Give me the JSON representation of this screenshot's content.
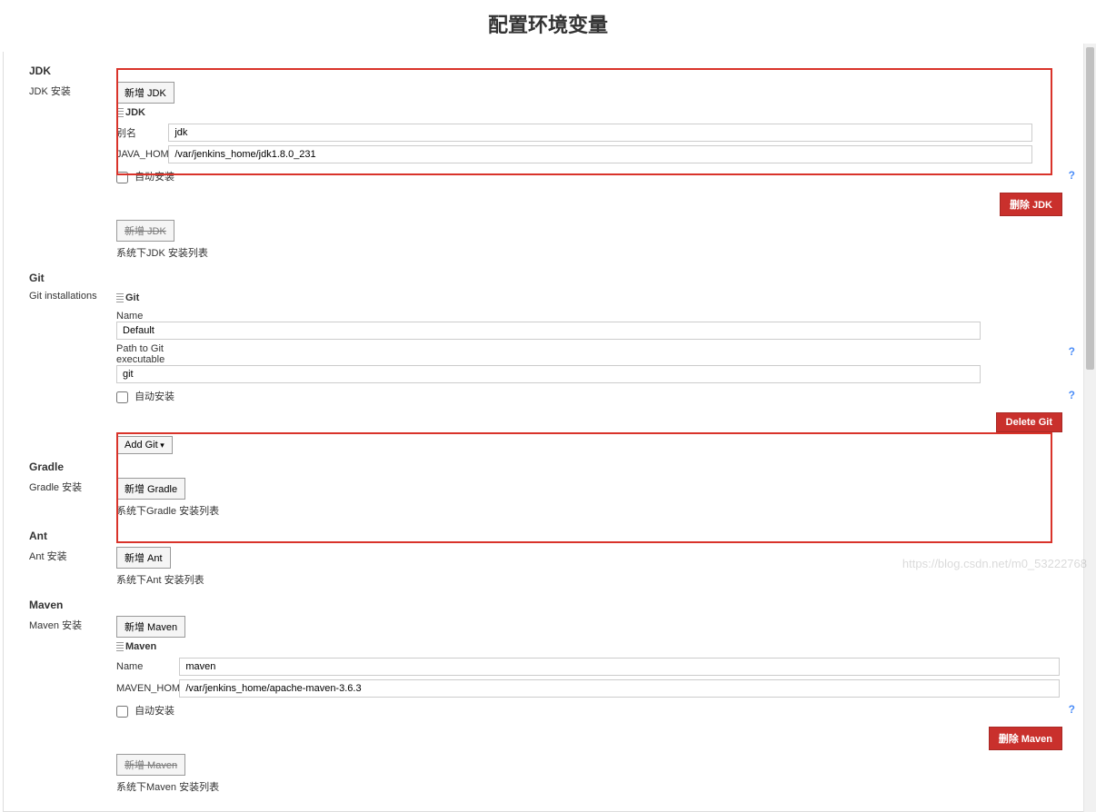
{
  "page": {
    "title": "配置环境变量"
  },
  "jdk": {
    "header": "JDK",
    "install_label": "JDK 安装",
    "add_button": "新增 JDK",
    "tool_title": "JDK",
    "alias_label": "别名",
    "alias_value": "jdk",
    "home_label": "JAVA_HOME",
    "home_value": "/var/jenkins_home/jdk1.8.0_231",
    "auto_install_label": "自动安装",
    "delete_button": "删除 JDK",
    "add_button2": "新增 JDK",
    "list_desc": "系统下JDK 安装列表"
  },
  "git": {
    "header": "Git",
    "install_label": "Git installations",
    "tool_title": "Git",
    "name_label": "Name",
    "name_value": "Default",
    "path_label": "Path to Git executable",
    "path_value": "git",
    "auto_install_label": "自动安装",
    "delete_button": "Delete Git",
    "add_button": "Add Git"
  },
  "gradle": {
    "header": "Gradle",
    "install_label": "Gradle 安装",
    "add_button": "新增 Gradle",
    "list_desc": "系统下Gradle 安装列表"
  },
  "ant": {
    "header": "Ant",
    "install_label": "Ant 安装",
    "add_button": "新增 Ant",
    "list_desc": "系统下Ant 安装列表"
  },
  "maven": {
    "header": "Maven",
    "install_label": "Maven 安装",
    "add_button": "新增 Maven",
    "tool_title": "Maven",
    "name_label": "Name",
    "name_value": "maven",
    "home_label": "MAVEN_HOME",
    "home_value": "/var/jenkins_home/apache-maven-3.6.3",
    "auto_install_label": "自动安装",
    "delete_button": "删除 Maven",
    "add_button2": "新增 Maven",
    "list_desc": "系统下Maven 安装列表"
  },
  "watermark": "https://blog.csdn.net/m0_53222768"
}
